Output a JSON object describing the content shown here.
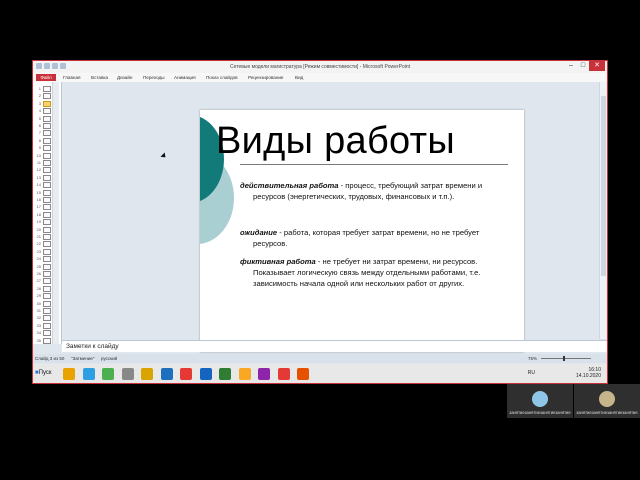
{
  "window": {
    "title": "Сетевые модели магистратура [Режим совместимости] - Microsoft PowerPoint"
  },
  "ribbon": {
    "file_tab": "Файл",
    "tabs": [
      "Главная",
      "Вставка",
      "Дизайн",
      "Переходы",
      "Анимация",
      "Показ слайдов",
      "Рецензирование",
      "Вид"
    ]
  },
  "thumbnails": {
    "numbers": [
      "1",
      "2",
      "3",
      "4",
      "5",
      "6",
      "7",
      "8",
      "9",
      "10",
      "11",
      "12",
      "13",
      "14",
      "15",
      "16",
      "17",
      "18",
      "19",
      "20",
      "21",
      "22",
      "23",
      "24",
      "25",
      "26",
      "27",
      "28",
      "29",
      "30",
      "31",
      "32",
      "33",
      "34",
      "35"
    ],
    "selected_index": 2
  },
  "slide": {
    "title": "Виды работы",
    "items": [
      {
        "term": "действительная работа",
        "text_line1": " - процесс, требующий затрат времени и",
        "text_line2": "ресурсов (энергетических, трудовых, финансовых и т.п.)."
      },
      {
        "term": "ожидание",
        "text_line1": " - работа, которая требует затрат времени, но не требует",
        "text_line2": "ресурсов."
      },
      {
        "term": "фиктивная работа",
        "text_line1": " - не требует ни затрат времени, ни ресурсов.",
        "text_line2": "Показывает логическую связь между отдельными работами, т.е. зависимость начала одной или нескольких работ от других."
      }
    ]
  },
  "notes": {
    "placeholder": "Заметки к слайду"
  },
  "statusbar": {
    "slide_info": "Слайд 3 из 50",
    "theme": "\"Затмение\"",
    "language": "русский",
    "zoom": "75%"
  },
  "taskbar": {
    "start_label": "Пуск",
    "language": "RU",
    "time": "16:10",
    "date": "14.10.2020",
    "icon_colors": [
      "#e8a300",
      "#2e9fe3",
      "#4caf50",
      "#888888",
      "#d9a400",
      "#1f6fbf",
      "#e53935",
      "#1565c0",
      "#2e7d32",
      "#f9a825",
      "#8e24aa",
      "#e53935",
      "#e65100"
    ]
  },
  "participants": [
    {
      "name": "занятиезанятиезанятиезанятие"
    },
    {
      "name": "занятиезанятиезанятиезанятие"
    }
  ]
}
